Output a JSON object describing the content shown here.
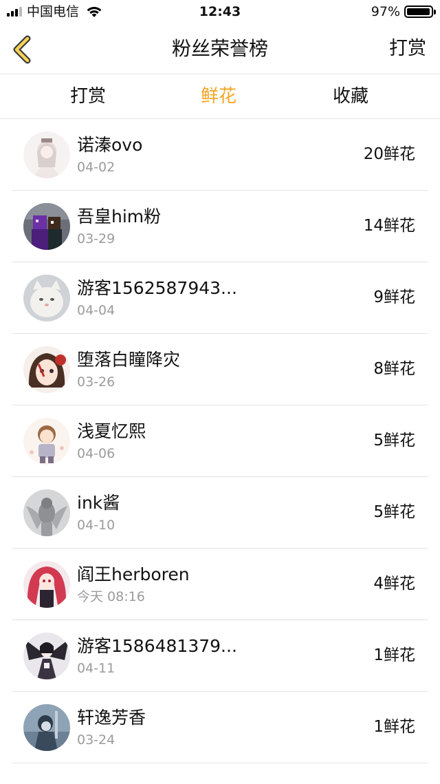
{
  "status_bar": {
    "carrier": "中国电信",
    "time": "12:43",
    "battery": "97%",
    "battery_level": 0.97
  },
  "nav": {
    "title": "粉丝荣誉榜",
    "action": "打赏",
    "accent_color": "#f5a623"
  },
  "tabs": [
    {
      "label": "打赏",
      "active": false
    },
    {
      "label": "鲜花",
      "active": true
    },
    {
      "label": "收藏",
      "active": false
    }
  ],
  "fans": [
    {
      "name": "诺溱ovo",
      "date": "04-02",
      "amount": "20鲜花",
      "avatar_icon": "anime-girl-avatar"
    },
    {
      "name": "吾皇him粉",
      "date": "03-29",
      "amount": "14鲜花",
      "avatar_icon": "pixel-character-avatar"
    },
    {
      "name": "游客1562587943...",
      "date": "04-04",
      "amount": "9鲜花",
      "avatar_icon": "white-cat-avatar"
    },
    {
      "name": "堕落白瞳降灾",
      "date": "03-26",
      "amount": "8鲜花",
      "avatar_icon": "anime-girl-avatar"
    },
    {
      "name": "浅夏忆熙",
      "date": "04-06",
      "amount": "5鲜花",
      "avatar_icon": "cartoon-child-avatar"
    },
    {
      "name": "ink酱",
      "date": "04-10",
      "amount": "5鲜花",
      "avatar_icon": "gray-figure-avatar"
    },
    {
      "name": "阎王herboren",
      "date": "今天 08:16",
      "amount": "4鲜花",
      "avatar_icon": "red-hair-girl-avatar"
    },
    {
      "name": "游客1586481379...",
      "date": "04-11",
      "amount": "1鲜花",
      "avatar_icon": "dark-wings-avatar"
    },
    {
      "name": "轩逸芳香",
      "date": "03-24",
      "amount": "1鲜花",
      "avatar_icon": "blue-figure-avatar"
    }
  ]
}
